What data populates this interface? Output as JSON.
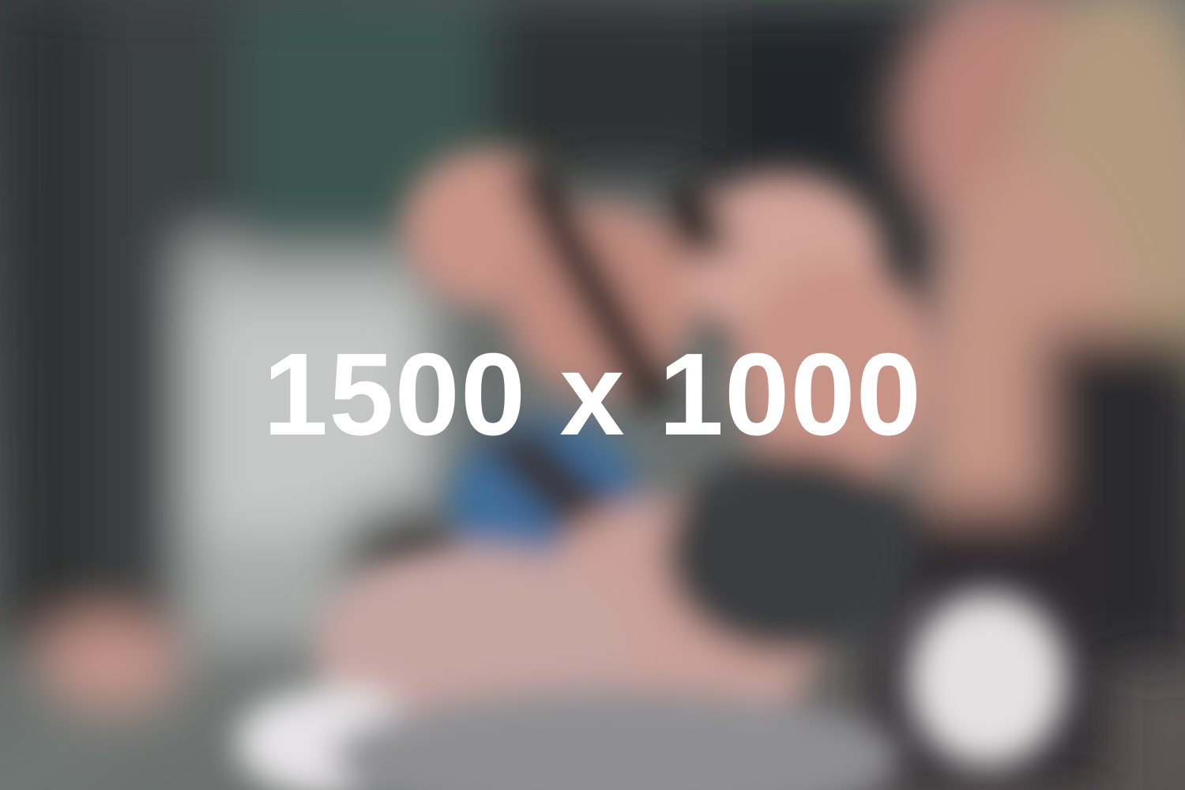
{
  "image": {
    "overlay_text": "1500 x 1000",
    "colors": {
      "overlay_text": "#ffffff",
      "background_dark": "#3a3f3f",
      "skin": "#c99488",
      "light_gray": "#a9acab",
      "phone_dark": "#2a2626",
      "jeans_blue": "#3f6e9c",
      "hair_blonde": "#b29a7e"
    }
  }
}
